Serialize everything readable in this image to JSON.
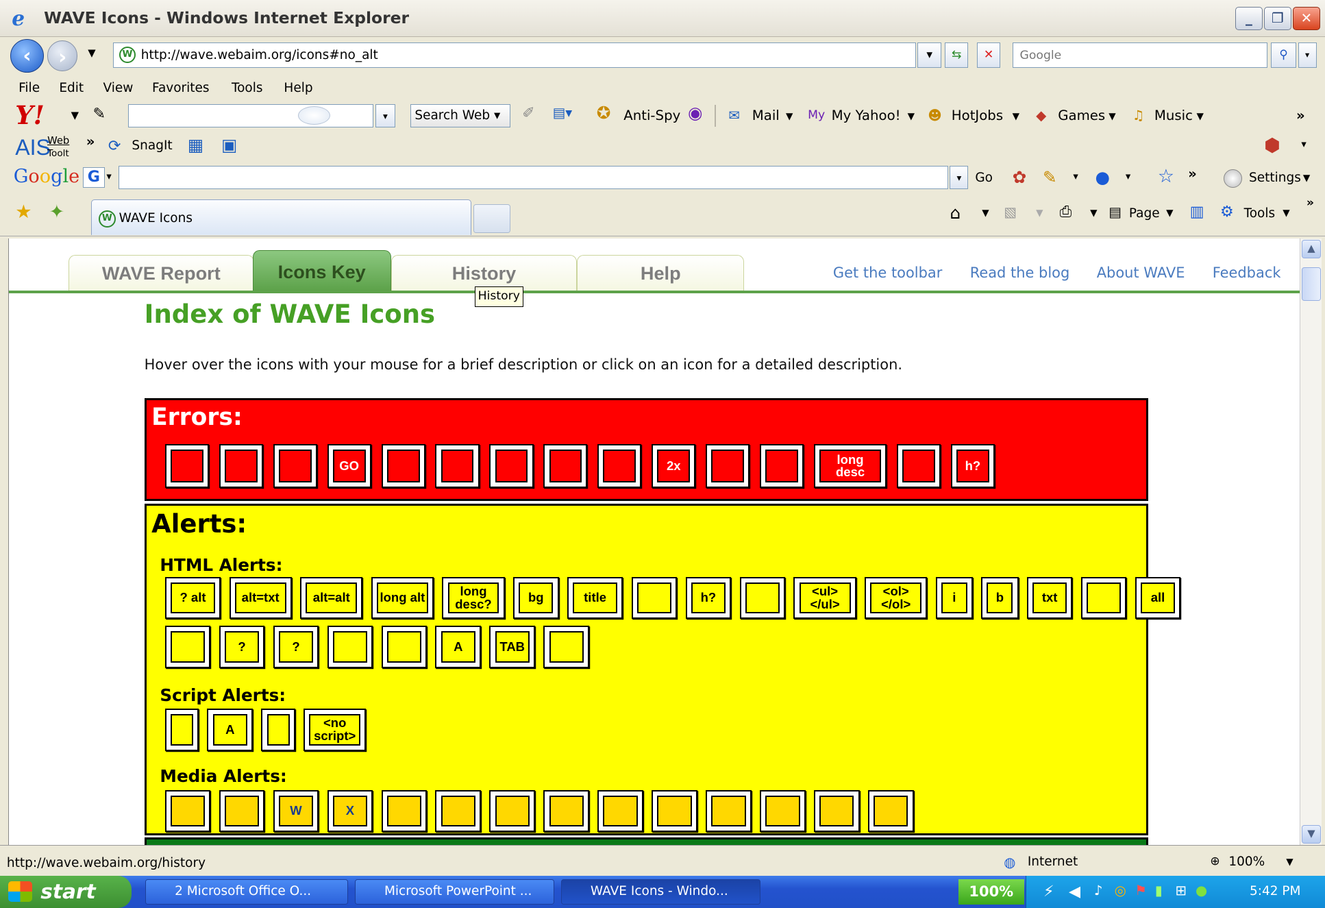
{
  "window": {
    "title": "WAVE Icons - Windows Internet Explorer",
    "min": "_",
    "max": "❐",
    "close": "✕"
  },
  "address": {
    "url": "http://wave.webaim.org/icons#no_alt",
    "search_placeholder": "Google"
  },
  "menu": [
    "File",
    "Edit",
    "View",
    "Favorites",
    "Tools",
    "Help"
  ],
  "yahoo_toolbar": {
    "search_button": "Search Web",
    "items": [
      "Anti-Spy",
      "Mail",
      "My Yahoo!",
      "HotJobs",
      "Games",
      "Music"
    ]
  },
  "ais_toolbar": {
    "logo": "AIS",
    "web": "Web",
    "tool": "Toolt",
    "snagit": "SnagIt"
  },
  "google_toolbar": {
    "go": "Go",
    "settings": "Settings"
  },
  "tab": {
    "title": "WAVE Icons"
  },
  "command_bar": {
    "page": "Page",
    "tools": "Tools"
  },
  "page": {
    "nav_tabs": [
      "WAVE Report",
      "Icons Key",
      "History",
      "Help"
    ],
    "active_tab": "Icons Key",
    "top_links": [
      "Get the toolbar",
      "Read the blog",
      "About WAVE",
      "Feedback"
    ],
    "tooltip": "History",
    "heading": "Index of WAVE Icons",
    "intro": "Hover over the icons with your mouse for a brief description or click on an icon for a detailed description.",
    "errors_heading": "Errors:",
    "error_icons": [
      "",
      "",
      "",
      "GO",
      "",
      "",
      "",
      "",
      "",
      "2x",
      "",
      "",
      "long desc",
      "",
      "h?"
    ],
    "alerts_heading": "Alerts:",
    "html_alerts_heading": "HTML Alerts:",
    "html_alert_icons_row1": [
      "? alt",
      "alt=txt",
      "alt=alt",
      "long alt",
      "long desc?",
      "bg",
      "title",
      "",
      "h?",
      "",
      "<ul> </ul>",
      "<ol> </ol>",
      "i",
      "b",
      "txt",
      "",
      "all"
    ],
    "html_alert_icons_row2": [
      "",
      "?",
      "?",
      "",
      "",
      "A",
      "TAB",
      ""
    ],
    "script_alerts_heading": "Script Alerts:",
    "script_alert_icons": [
      "",
      "A",
      "",
      "<no script>"
    ],
    "media_alerts_heading": "Media Alerts:",
    "media_alert_icons": [
      "",
      "",
      "W",
      "X",
      "",
      "",
      "",
      "",
      "",
      "",
      "",
      "",
      "",
      ""
    ]
  },
  "status_bar": {
    "url": "http://wave.webaim.org/history",
    "zone": "Internet",
    "zoom": "100%"
  },
  "taskbar": {
    "start": "start",
    "tasks": [
      "2 Microsoft Office O...",
      "Microsoft PowerPoint ...",
      "WAVE Icons - Windo..."
    ],
    "battery": "100%",
    "clock": "5:42 PM"
  }
}
